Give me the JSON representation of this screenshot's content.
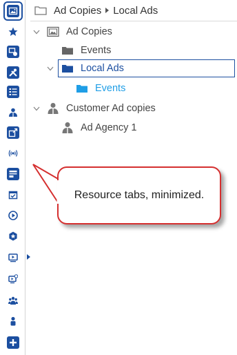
{
  "rail": {
    "icons": [
      "image-gallery-icon",
      "star-icon",
      "timer-badge-icon",
      "tools-icon",
      "checklist-icon",
      "user-group-icon",
      "resize-window-icon",
      "broadcast-icon",
      "form-icon",
      "calendar-check-icon",
      "play-circle-icon",
      "badge-star-icon",
      "video-player-icon",
      "screen-check-icon",
      "team-icon",
      "person-icon",
      "add-icon"
    ]
  },
  "breadcrumb": {
    "root": "Ad Copies",
    "current": "Local Ads"
  },
  "tree": {
    "nodes": [
      {
        "label": "Ad Copies",
        "icon": "image-folder-icon"
      },
      {
        "label": "Events",
        "icon": "folder-icon"
      },
      {
        "label": "Local Ads",
        "icon": "folder-icon"
      },
      {
        "label": "Events",
        "icon": "folder-icon"
      },
      {
        "label": "Customer Ad copies",
        "icon": "user-group-icon"
      },
      {
        "label": "Ad Agency 1",
        "icon": "user-group-icon"
      }
    ]
  },
  "callout": {
    "text": "Resource tabs, minimized."
  },
  "colors": {
    "accent": "#1c4fa0",
    "selected_child": "#1f9ee6",
    "callout_border": "#d52f2f"
  }
}
